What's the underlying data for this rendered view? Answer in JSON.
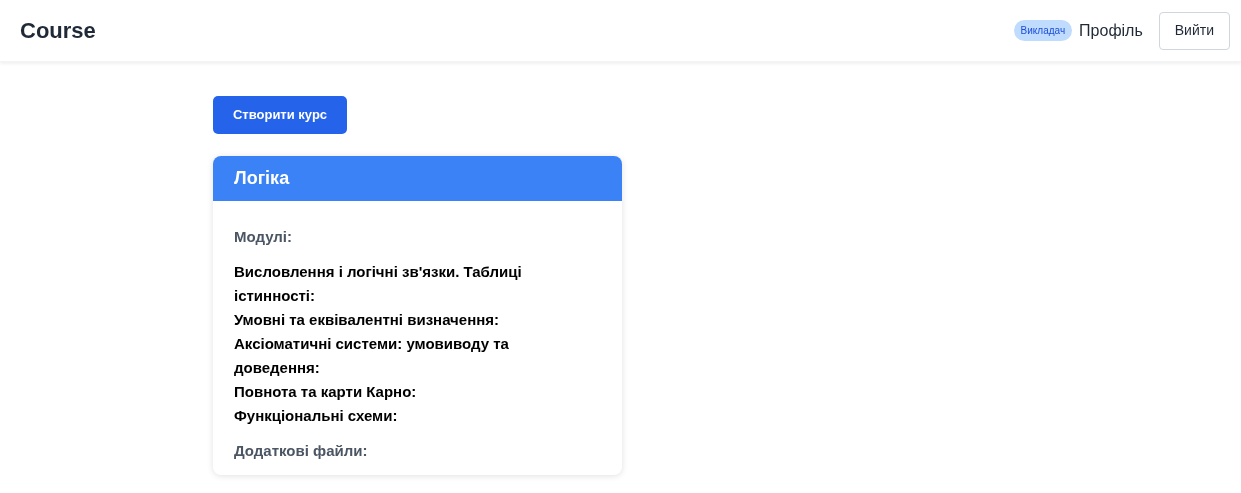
{
  "header": {
    "title": "Course",
    "role_badge": "Викладач",
    "profile_link": "Профіль",
    "logout_button": "Вийти"
  },
  "create_button": "Створити курс",
  "courses": [
    {
      "title": "Логіка",
      "modules_heading": "Модулі:",
      "modules": [
        "Висловлення і логічні зв'язки. Таблиці істинності:",
        "Умовні та еквівалентні визначення:",
        "Аксіоматичні системи: умовиводу та доведення:",
        "Повнота та карти Карно:",
        "Функціональні схеми:"
      ],
      "files_heading": "Додаткові файли:"
    }
  ]
}
